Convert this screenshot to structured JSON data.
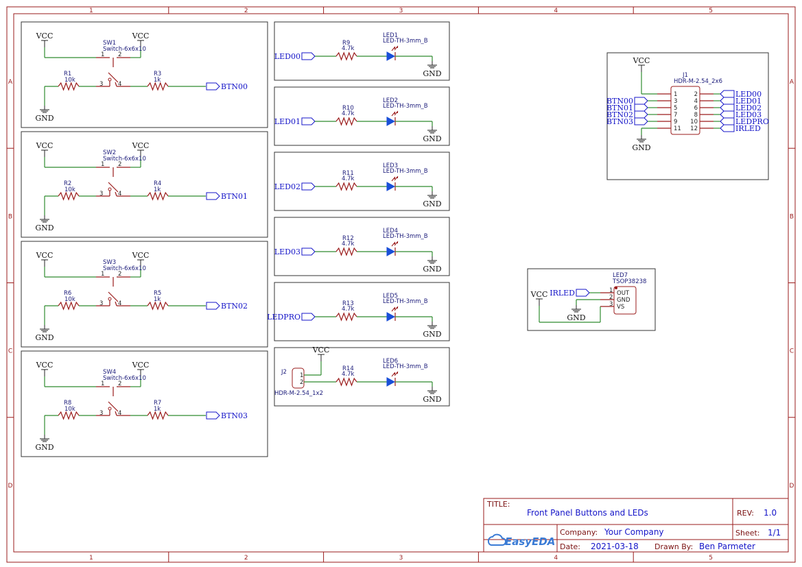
{
  "frame": {
    "cols": [
      "1",
      "2",
      "3",
      "4",
      "5"
    ],
    "rows": [
      "A",
      "B",
      "C",
      "D"
    ]
  },
  "buttons": [
    {
      "sw": "SW1",
      "sw_val": "Switch-6x6x10",
      "rpd": "R1",
      "rpd_val": "10k",
      "rs": "R3",
      "rs_val": "1k",
      "net": "BTN00"
    },
    {
      "sw": "SW2",
      "sw_val": "Switch-6x6x10",
      "rpd": "R2",
      "rpd_val": "10k",
      "rs": "R4",
      "rs_val": "1k",
      "net": "BTN01"
    },
    {
      "sw": "SW3",
      "sw_val": "Switch-6x6x10",
      "rpd": "R6",
      "rpd_val": "10k",
      "rs": "R5",
      "rs_val": "1k",
      "net": "BTN02"
    },
    {
      "sw": "SW4",
      "sw_val": "Switch-6x6x10",
      "rpd": "R8",
      "rpd_val": "10k",
      "rs": "R7",
      "rs_val": "1k",
      "net": "BTN03"
    }
  ],
  "button_pins": [
    "1",
    "2",
    "3",
    "4"
  ],
  "leds": [
    {
      "net": "LED00",
      "r": "R9",
      "r_val": "4.7k",
      "led": "LED1",
      "led_val": "LED-TH-3mm_B"
    },
    {
      "net": "LED01",
      "r": "R10",
      "r_val": "4.7k",
      "led": "LED2",
      "led_val": "LED-TH-3mm_B"
    },
    {
      "net": "LED02",
      "r": "R11",
      "r_val": "4.7k",
      "led": "LED3",
      "led_val": "LED-TH-3mm_B"
    },
    {
      "net": "LED03",
      "r": "R12",
      "r_val": "4.7k",
      "led": "LED4",
      "led_val": "LED-TH-3mm_B"
    },
    {
      "net": "LEDPRO",
      "r": "R13",
      "r_val": "4.7k",
      "led": "LED5",
      "led_val": "LED-TH-3mm_B"
    }
  ],
  "jumper": {
    "ref": "J2",
    "value": "HDR-M-2.54_1x2",
    "pins": [
      "1",
      "2"
    ],
    "r": "R14",
    "r_val": "4.7k",
    "led": "LED6",
    "led_val": "LED-TH-3mm_B"
  },
  "power": {
    "vcc": "VCC",
    "gnd": "GND"
  },
  "header": {
    "ref": "J1",
    "value": "HDR-M-2.54_2x6",
    "left_pins": [
      "1",
      "3",
      "5",
      "7",
      "9",
      "11"
    ],
    "right_pins": [
      "2",
      "4",
      "6",
      "8",
      "10",
      "12"
    ],
    "left_nets": [
      "BTN00",
      "BTN01",
      "BTN02",
      "BTN03"
    ],
    "right_nets": [
      "LED00",
      "LED01",
      "LED02",
      "LED03",
      "LEDPRO",
      "IRLED"
    ]
  },
  "ir": {
    "ref": "LED7",
    "value": "TSOP38238",
    "net": "IRLED",
    "pins": [
      "1",
      "2",
      "3"
    ],
    "pin_names": [
      "OUT",
      "GND",
      "VS"
    ]
  },
  "title_block": {
    "title_label": "TITLE:",
    "title": "Front Panel Buttons and LEDs",
    "rev_label": "REV:",
    "rev": "1.0",
    "company_label": "Company:",
    "company": "Your Company",
    "sheet_label": "Sheet:",
    "sheet": "1/1",
    "date_label": "Date:",
    "date": "2021-03-18",
    "drawn_label": "Drawn By:",
    "drawn_by": "Ben Parmeter",
    "logo": "EasyEDA"
  }
}
